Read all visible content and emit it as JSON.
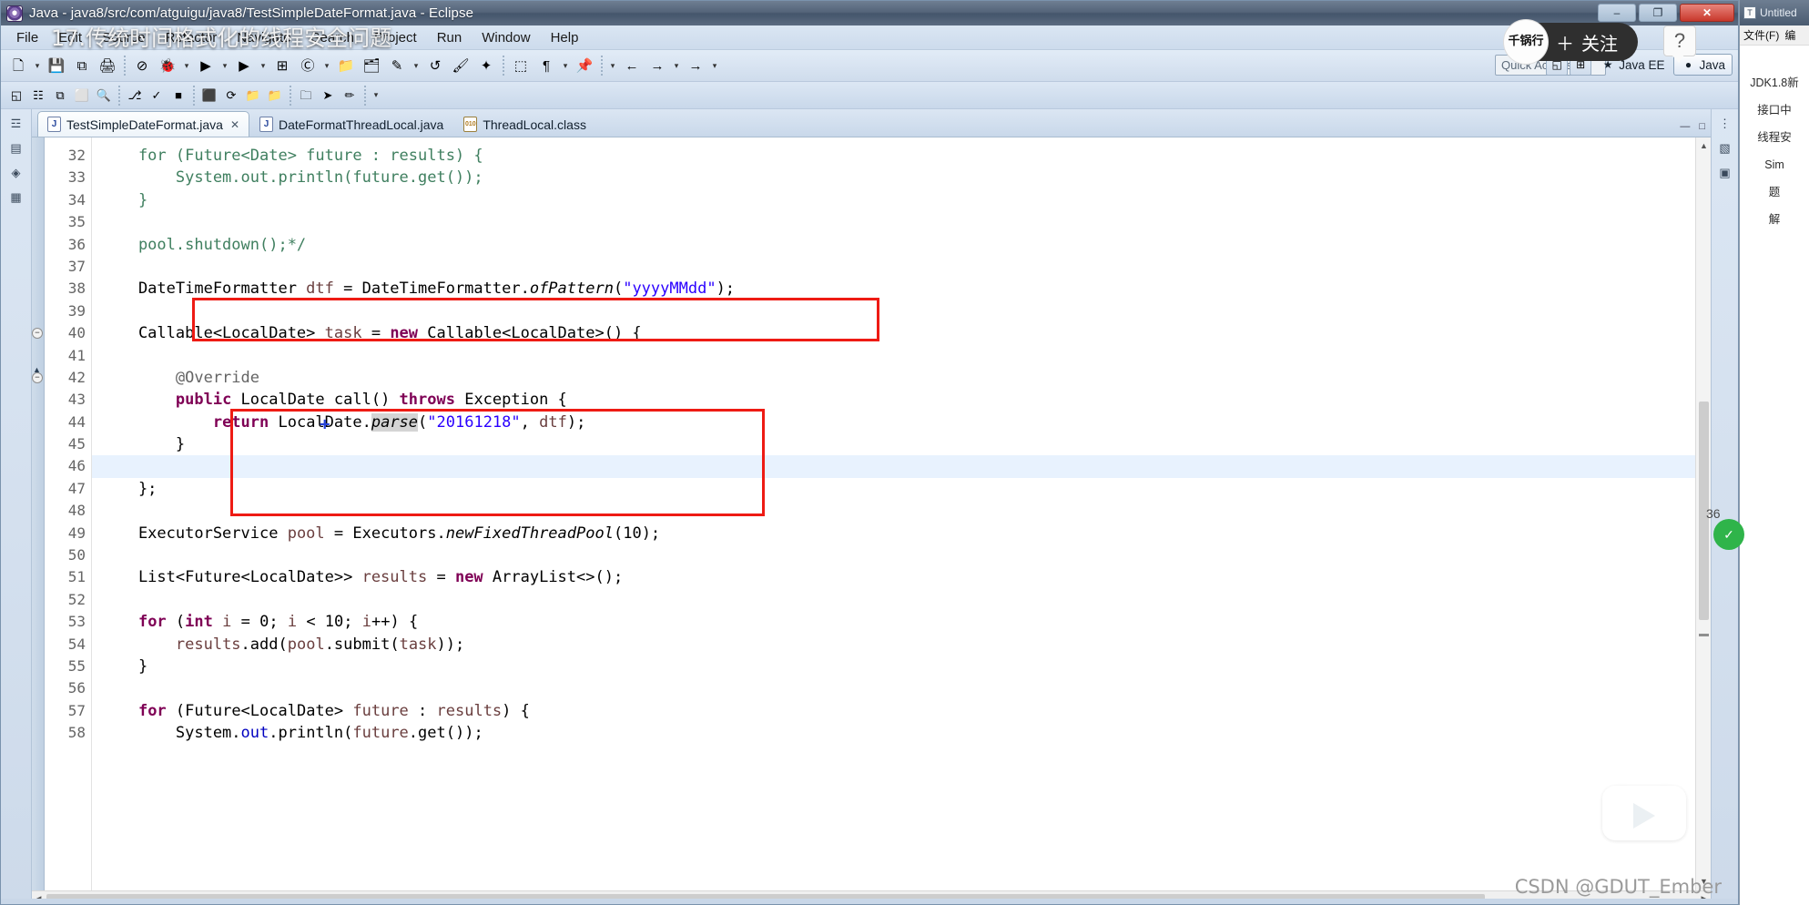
{
  "window": {
    "title": "Java - java8/src/com/atguigu/java8/TestSimpleDateFormat.java - Eclipse",
    "app_icon": "eclipse-icon",
    "minimize_label": "–",
    "maximize_label": "❐",
    "close_label": "✕"
  },
  "menubar": {
    "items": [
      {
        "label": "File"
      },
      {
        "label": "Edit"
      },
      {
        "label": "Source"
      },
      {
        "label": "Refactor"
      },
      {
        "label": "Navigate"
      },
      {
        "label": "Search"
      },
      {
        "label": "Project"
      },
      {
        "label": "Run"
      },
      {
        "label": "Window"
      },
      {
        "label": "Help"
      }
    ]
  },
  "toolbar": {
    "quick_access_placeholder": "Quick Access",
    "buttons": [
      {
        "name": "new-button",
        "glyph": "🗋"
      },
      {
        "name": "new-dropdown",
        "glyph": "▾"
      },
      {
        "name": "save-button",
        "glyph": "💾"
      },
      {
        "name": "save-all-button",
        "glyph": "⧉"
      },
      {
        "name": "print-button",
        "glyph": "🖨"
      },
      {
        "name": "toggle-markers-button",
        "glyph": "⊘"
      },
      {
        "name": "debug-button",
        "glyph": "🐞"
      },
      {
        "name": "debug-dropdown",
        "glyph": "▾"
      },
      {
        "name": "run-button",
        "glyph": "▶"
      },
      {
        "name": "run-dropdown",
        "glyph": "▾"
      },
      {
        "name": "run-last-tool-button",
        "glyph": "▶"
      },
      {
        "name": "run-last-tool-dropdown",
        "glyph": "▾"
      },
      {
        "name": "new-java-package-button",
        "glyph": "⊞"
      },
      {
        "name": "new-java-class-button",
        "glyph": "Ⓒ"
      },
      {
        "name": "new-class-dropdown",
        "glyph": "▾"
      },
      {
        "name": "open-type-button",
        "glyph": "📁"
      },
      {
        "name": "open-task-button",
        "glyph": "🗂"
      },
      {
        "name": "search-button",
        "glyph": "✎"
      },
      {
        "name": "search-dropdown",
        "glyph": "▾"
      },
      {
        "name": "last-edit-location-button",
        "glyph": "↺"
      },
      {
        "name": "toggle-mark-occurrences-button",
        "glyph": "🖌"
      },
      {
        "name": "skip-breakpoints-button",
        "glyph": "✦"
      },
      {
        "name": "next-annotation-button",
        "glyph": "⬚"
      },
      {
        "name": "previous-annotation-button",
        "glyph": "¶"
      },
      {
        "name": "back-history-dropdown",
        "glyph": "▾"
      },
      {
        "name": "pin-editor-button",
        "glyph": "📌"
      },
      {
        "name": "pin-dropdown",
        "glyph": "▾"
      },
      {
        "name": "back-button",
        "glyph": "←"
      },
      {
        "name": "forward-button",
        "glyph": "→"
      },
      {
        "name": "forward-dropdown",
        "glyph": "▾"
      },
      {
        "name": "next-edit-button",
        "glyph": "→"
      },
      {
        "name": "next-dropdown",
        "glyph": "▾"
      }
    ],
    "row2_buttons": [
      {
        "name": "open-perspective-button",
        "glyph": "◱"
      },
      {
        "name": "coverage-button",
        "glyph": "☷"
      },
      {
        "name": "history-button",
        "glyph": "⧉"
      },
      {
        "name": "terminal-button",
        "glyph": "⬜"
      },
      {
        "name": "zoom-button",
        "glyph": "🔍"
      },
      {
        "name": "branch-button",
        "glyph": "⎇"
      },
      {
        "name": "validate-button",
        "glyph": "✓"
      },
      {
        "name": "stop-button",
        "glyph": "■"
      },
      {
        "name": "package-button",
        "glyph": "⬛"
      },
      {
        "name": "refresh-button",
        "glyph": "⟳"
      },
      {
        "name": "folder-one-button",
        "glyph": "📁"
      },
      {
        "name": "folder-two-button",
        "glyph": "📁"
      },
      {
        "name": "folder-three-button",
        "glyph": "🗀"
      },
      {
        "name": "cursor-button",
        "glyph": "➤"
      },
      {
        "name": "highlight-button",
        "glyph": "✏"
      },
      {
        "name": "highlight-dropdown",
        "glyph": "▾"
      }
    ],
    "perspective": {
      "customize_icon": "⊞",
      "open_perspective_icon": "◱",
      "tabs": [
        {
          "label": "Java EE",
          "icon": "java-ee-icon",
          "active": false
        },
        {
          "label": "Java",
          "icon": "java-icon",
          "active": true
        }
      ]
    }
  },
  "left_rail": {
    "items": [
      {
        "name": "package-explorer-rail-icon",
        "glyph": "☲"
      },
      {
        "name": "outline-rail-icon",
        "glyph": "▤"
      },
      {
        "name": "type-hierarchy-rail-icon",
        "glyph": "◈"
      },
      {
        "name": "task-list-rail-icon",
        "glyph": "▦"
      }
    ]
  },
  "right_rail": {
    "items": [
      {
        "name": "outline-view-rail-icon",
        "glyph": "⋮"
      },
      {
        "name": "task-list-rail-icon",
        "glyph": "▧"
      },
      {
        "name": "minimap-rail-icon",
        "glyph": "▣"
      }
    ]
  },
  "editor_tabs": {
    "tabs": [
      {
        "label": "TestSimpleDateFormat.java",
        "icon_letter": "J",
        "icon_kind": "java-file-icon",
        "active": true,
        "close_glyph": "✕"
      },
      {
        "label": "DateFormatThreadLocal.java",
        "icon_letter": "J",
        "icon_kind": "java-file-icon",
        "active": false,
        "close_glyph": ""
      },
      {
        "label": "ThreadLocal.class",
        "icon_letter": "010",
        "icon_kind": "class-file-icon",
        "active": false,
        "close_glyph": ""
      }
    ],
    "minimize_glyph": "—",
    "maximize_glyph": "□"
  },
  "code": {
    "first_line_number": 32,
    "highlight_line": 46,
    "fold_lines": [
      40,
      42
    ],
    "lines": [
      {
        "n": 32,
        "tokens": [
          {
            "t": "    for (Future<Date> future : results) {",
            "c": "cmt"
          }
        ]
      },
      {
        "n": 33,
        "tokens": [
          {
            "t": "        System.out.println(future.get());",
            "c": "cmt"
          }
        ]
      },
      {
        "n": 34,
        "tokens": [
          {
            "t": "    }",
            "c": "cmt"
          }
        ]
      },
      {
        "n": 35,
        "tokens": [
          {
            "t": "",
            "c": "cmt"
          }
        ]
      },
      {
        "n": 36,
        "tokens": [
          {
            "t": "    pool.shutdown();*/",
            "c": "cmt"
          }
        ]
      },
      {
        "n": 37,
        "tokens": [
          {
            "t": "",
            "c": "pln"
          }
        ]
      },
      {
        "n": 38,
        "tokens": [
          {
            "t": "    DateTimeFormatter ",
            "c": "pln"
          },
          {
            "t": "dtf",
            "c": "loc"
          },
          {
            "t": " = DateTimeFormatter.",
            "c": "pln"
          },
          {
            "t": "ofPattern",
            "c": "mth"
          },
          {
            "t": "(",
            "c": "pln"
          },
          {
            "t": "\"yyyyMMdd\"",
            "c": "str"
          },
          {
            "t": ");",
            "c": "pln"
          }
        ]
      },
      {
        "n": 39,
        "tokens": [
          {
            "t": "",
            "c": "pln"
          }
        ]
      },
      {
        "n": 40,
        "tokens": [
          {
            "t": "    Callable<LocalDate> ",
            "c": "pln"
          },
          {
            "t": "task",
            "c": "loc"
          },
          {
            "t": " = ",
            "c": "pln"
          },
          {
            "t": "new",
            "c": "k"
          },
          {
            "t": " Callable<LocalDate>() {",
            "c": "pln"
          }
        ]
      },
      {
        "n": 41,
        "tokens": [
          {
            "t": "",
            "c": "pln"
          }
        ]
      },
      {
        "n": 42,
        "tokens": [
          {
            "t": "        @Override",
            "c": "ann"
          }
        ]
      },
      {
        "n": 43,
        "tokens": [
          {
            "t": "        ",
            "c": "pln"
          },
          {
            "t": "public",
            "c": "k"
          },
          {
            "t": " LocalDate call() ",
            "c": "pln"
          },
          {
            "t": "throws",
            "c": "k"
          },
          {
            "t": " Exception {",
            "c": "pln"
          }
        ]
      },
      {
        "n": 44,
        "tokens": [
          {
            "t": "            ",
            "c": "pln"
          },
          {
            "t": "return",
            "c": "k"
          },
          {
            "t": " LocalDate.",
            "c": "pln"
          },
          {
            "t": "parse",
            "c": "mth hi"
          },
          {
            "t": "(",
            "c": "pln"
          },
          {
            "t": "\"20161218\"",
            "c": "str"
          },
          {
            "t": ", ",
            "c": "pln"
          },
          {
            "t": "dtf",
            "c": "loc"
          },
          {
            "t": ");",
            "c": "pln"
          }
        ]
      },
      {
        "n": 45,
        "tokens": [
          {
            "t": "        }",
            "c": "pln"
          }
        ]
      },
      {
        "n": 46,
        "tokens": [
          {
            "t": "",
            "c": "pln"
          }
        ]
      },
      {
        "n": 47,
        "tokens": [
          {
            "t": "    };",
            "c": "pln"
          }
        ]
      },
      {
        "n": 48,
        "tokens": [
          {
            "t": "",
            "c": "pln"
          }
        ]
      },
      {
        "n": 49,
        "tokens": [
          {
            "t": "    ExecutorService ",
            "c": "pln"
          },
          {
            "t": "pool",
            "c": "loc"
          },
          {
            "t": " = Executors.",
            "c": "pln"
          },
          {
            "t": "newFixedThreadPool",
            "c": "mth"
          },
          {
            "t": "(",
            "c": "pln"
          },
          {
            "t": "10",
            "c": "pln"
          },
          {
            "t": ");",
            "c": "pln"
          }
        ]
      },
      {
        "n": 50,
        "tokens": [
          {
            "t": "",
            "c": "pln"
          }
        ]
      },
      {
        "n": 51,
        "tokens": [
          {
            "t": "    List<Future<LocalDate>> ",
            "c": "pln"
          },
          {
            "t": "results",
            "c": "loc"
          },
          {
            "t": " = ",
            "c": "pln"
          },
          {
            "t": "new",
            "c": "k"
          },
          {
            "t": " ArrayList<>();",
            "c": "pln"
          }
        ]
      },
      {
        "n": 52,
        "tokens": [
          {
            "t": "",
            "c": "pln"
          }
        ]
      },
      {
        "n": 53,
        "tokens": [
          {
            "t": "    ",
            "c": "pln"
          },
          {
            "t": "for",
            "c": "k"
          },
          {
            "t": " (",
            "c": "pln"
          },
          {
            "t": "int",
            "c": "k"
          },
          {
            "t": " ",
            "c": "pln"
          },
          {
            "t": "i",
            "c": "loc"
          },
          {
            "t": " = ",
            "c": "pln"
          },
          {
            "t": "0",
            "c": "pln"
          },
          {
            "t": "; ",
            "c": "pln"
          },
          {
            "t": "i",
            "c": "loc"
          },
          {
            "t": " < ",
            "c": "pln"
          },
          {
            "t": "10",
            "c": "pln"
          },
          {
            "t": "; ",
            "c": "pln"
          },
          {
            "t": "i",
            "c": "loc"
          },
          {
            "t": "++) {",
            "c": "pln"
          }
        ]
      },
      {
        "n": 54,
        "tokens": [
          {
            "t": "        ",
            "c": "pln"
          },
          {
            "t": "results",
            "c": "loc"
          },
          {
            "t": ".add(",
            "c": "pln"
          },
          {
            "t": "pool",
            "c": "loc"
          },
          {
            "t": ".submit(",
            "c": "pln"
          },
          {
            "t": "task",
            "c": "loc"
          },
          {
            "t": "));",
            "c": "pln"
          }
        ]
      },
      {
        "n": 55,
        "tokens": [
          {
            "t": "    }",
            "c": "pln"
          }
        ]
      },
      {
        "n": 56,
        "tokens": [
          {
            "t": "",
            "c": "pln"
          }
        ]
      },
      {
        "n": 57,
        "tokens": [
          {
            "t": "    ",
            "c": "pln"
          },
          {
            "t": "for",
            "c": "k"
          },
          {
            "t": " (Future<LocalDate> ",
            "c": "pln"
          },
          {
            "t": "future",
            "c": "loc"
          },
          {
            "t": " : ",
            "c": "pln"
          },
          {
            "t": "results",
            "c": "loc"
          },
          {
            "t": ") {",
            "c": "pln"
          }
        ]
      },
      {
        "n": 58,
        "tokens": [
          {
            "t": "        System.",
            "c": "pln"
          },
          {
            "t": "out",
            "c": "fld"
          },
          {
            "t": ".println(",
            "c": "pln"
          },
          {
            "t": "future",
            "c": "loc"
          },
          {
            "t": ".get());",
            "c": "pln"
          }
        ]
      }
    ]
  },
  "scrollbars": {
    "v_up_glyph": "▲",
    "v_down_glyph": "▼",
    "h_left_glyph": "◀",
    "h_right_glyph": "▶"
  },
  "notepad": {
    "title": "Untitled",
    "icon": "notepad-icon",
    "menu": [
      "文件(F)",
      "编"
    ],
    "lines": [
      "JDK1.8新",
      "接口中",
      "线程安",
      "Sim",
      "题",
      "解"
    ]
  },
  "overlays": {
    "video_title": "17.传统时间格式化的线程安全问题",
    "follow_button": "关注",
    "follow_plus": "＋",
    "avatar_text": "千锅行",
    "help_glyph": "?",
    "side_badge_glyph": "✓",
    "side_badge_number": "36",
    "watermark": "CSDN @GDUT_Ember",
    "bilibili_logo": "bilibili-play-icon"
  },
  "colors": {
    "accent_red": "#ee1b14",
    "keyword": "#7f0055",
    "string": "#2a00ff",
    "comment": "#3f7f5f",
    "annotation": "#646464",
    "field": "#0000c0",
    "local_var": "#6a3e3e",
    "highlight_line": "#e8f2fe",
    "title_bar": "#55657a"
  }
}
